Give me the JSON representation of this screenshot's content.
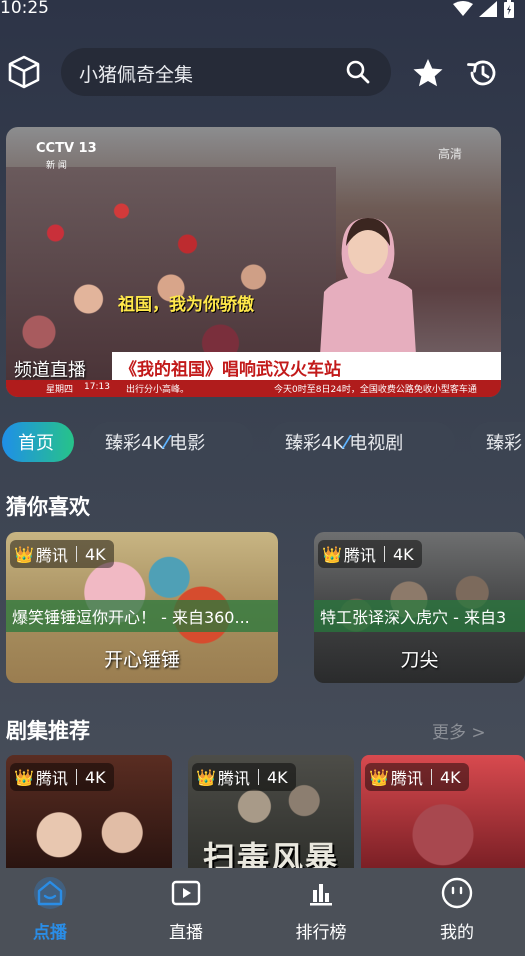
{
  "status_bar": {
    "time": "10:25"
  },
  "search": {
    "query": "小猪佩奇全集"
  },
  "banner": {
    "channel_logo": "CCTV 13",
    "channel_sub": "新 闻",
    "hd": "高清",
    "caption": "祖国，我为你骄傲",
    "headline": "《我的祖国》唱响武汉火车站",
    "ticker_day": "星期四",
    "ticker_time": "17:13",
    "ticker_text": "出行分小高峰。",
    "ticker_text2": "今天0时至8日24时，全国收费公路免收小型客车通",
    "label": "频道直播"
  },
  "tabs": [
    {
      "label": "首页"
    },
    {
      "prefix": "臻彩4K",
      "slash": "⁄",
      "suffix": "电影"
    },
    {
      "prefix": "臻彩4K",
      "slash": "⁄",
      "suffix": "电视剧"
    },
    {
      "prefix": "臻彩"
    }
  ],
  "sections": {
    "guess": {
      "title": "猜你喜欢"
    },
    "series": {
      "title": "剧集推荐",
      "more": "更多 >"
    }
  },
  "badge": {
    "crown": "👑",
    "source": "腾讯",
    "quality": "4K"
  },
  "guess_cards": [
    {
      "desc": "爆笑锤锤逗你开心！ - 来自360...",
      "title": "开心锤锤"
    },
    {
      "desc": "特工张译深入虎穴 - 来自3",
      "title": "刀尖"
    }
  ],
  "series_posters": [
    {
      "title": ""
    },
    {
      "title": "扫毒风暴"
    },
    {
      "title": ""
    }
  ],
  "bottom_nav": [
    {
      "label": "点播",
      "icon": "home-icon",
      "active": true
    },
    {
      "label": "直播",
      "icon": "tv-icon",
      "active": false
    },
    {
      "label": "排行榜",
      "icon": "chart-icon",
      "active": false
    },
    {
      "label": "我的",
      "icon": "profile-icon",
      "active": false
    }
  ],
  "colors": {
    "accent_blue": "#2a8de6",
    "tab_gradient_start": "#1f8fe8",
    "tab_gradient_end": "#27c389",
    "headline_red": "#c21a1a"
  }
}
